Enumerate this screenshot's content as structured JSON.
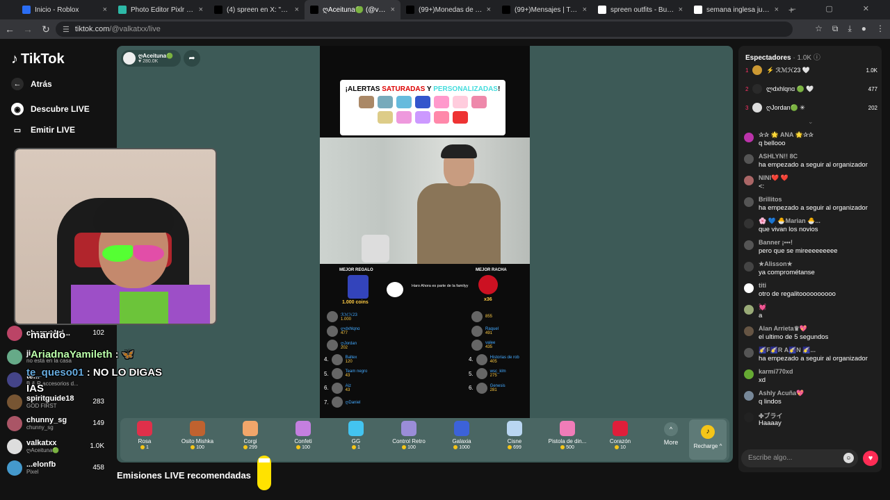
{
  "browser": {
    "tabs": [
      {
        "title": "Inicio - Roblox",
        "fav": "#2a6df4",
        "close": "×"
      },
      {
        "title": "Photo Editor Pixlr - Herra",
        "fav": "#2db9a7",
        "close": "×"
      },
      {
        "title": "(4) spreen en X: \"2 días p",
        "fav": "#000",
        "close": "×"
      },
      {
        "title": "ღAceituna🟢 (@valk",
        "fav": "#000",
        "close": "×",
        "active": true
      },
      {
        "title": "(99+)Monedas de TikTok",
        "fav": "#000",
        "close": "×"
      },
      {
        "title": "(99+)Mensajes | TikTok",
        "fav": "#000",
        "close": "×"
      },
      {
        "title": "spreen outfits - Buscar co",
        "fav": "#fff",
        "close": "×"
      },
      {
        "title": "semana inglesa juego co",
        "fav": "#fff",
        "close": "×"
      }
    ],
    "new_tab": "+",
    "url_host": "tiktok.com",
    "url_path": "/@valkatxx/live"
  },
  "sidebar": {
    "brand": "TikTok",
    "back": "Atrás",
    "discover": "Descubre LIVE",
    "emit": "Emitir LIVE",
    "channels": [
      {
        "name": "cherryabri...",
        "sub": "",
        "count": "102",
        "color": "#b46"
      },
      {
        "name": "ji...",
        "sub": "no está en la casa",
        "count": "",
        "color": "#6a8"
      },
      {
        "name": "te...",
        "sub": "B & R accesorios d...",
        "count": "",
        "color": "#448"
      },
      {
        "name": "spiritguide18",
        "sub": "GOD FIRST",
        "count": "283",
        "color": "#753"
      },
      {
        "name": "chunny_sg",
        "sub": "chunny_sg",
        "count": "149",
        "color": "#a56"
      },
      {
        "name": "valkatxx",
        "sub": "ღAceituna🟢",
        "count": "1.0K",
        "color": "#ddd"
      },
      {
        "name": "...elonfb",
        "sub": "Pixel",
        "count": "458",
        "color": "#49c"
      }
    ]
  },
  "player": {
    "host_name": "ღAceituna🟢",
    "host_likes": "♥ 280.0K",
    "alert_title_1": "¡ALERTAS",
    "alert_title_2": "SATURADAS",
    "alert_title_3": "Y",
    "alert_title_4": "PERSONALIZADAS",
    "alert_title_5": "!",
    "best_gift": "MEJOR REGALO",
    "best_streak": "MEJOR RACHA",
    "coins": "1.000 coins",
    "streak": "x36",
    "family": "Haro  Ahora es parte de la familyy",
    "left_rank": [
      {
        "n": "",
        "name": "ℛℳℋ23",
        "c": "1.000"
      },
      {
        "n": "",
        "name": "ლdxhlqnɑ",
        "c": "477"
      },
      {
        "n": "",
        "name": "ღJordan",
        "c": "202"
      },
      {
        "n": "4.",
        "name": "Baltex",
        "c": "120"
      },
      {
        "n": "5.",
        "name": "Team negro",
        "c": "43"
      },
      {
        "n": "6.",
        "name": "Aiz",
        "c": "43"
      },
      {
        "n": "7.",
        "name": "ღDaniel",
        "c": ""
      }
    ],
    "right_rank": [
      {
        "n": "",
        "name": "",
        "c": "855"
      },
      {
        "n": "",
        "name": "Raquel",
        "c": "491"
      },
      {
        "n": "",
        "name": "valee",
        "c": "435"
      },
      {
        "n": "4.",
        "name": "Historias de rob",
        "c": "405"
      },
      {
        "n": "5.",
        "name": "wsc_klm",
        "c": "275"
      },
      {
        "n": "6.",
        "name": "Genesis",
        "c": "281"
      }
    ],
    "overlay_chat": [
      {
        "user": "",
        "text": "marido"
      },
      {
        "user": "AriadnaYamileth",
        "text": ": 🦋"
      },
      {
        "user": "te_queso01",
        "text": ": NO LO DIGAS"
      },
      {
        "user": "",
        "text": "IAS"
      }
    ]
  },
  "gifts": [
    {
      "name": "Rosa",
      "price": "1",
      "color": "#e0304a"
    },
    {
      "name": "Osito Mishka",
      "price": "100",
      "color": "#c0622f"
    },
    {
      "name": "Corgi",
      "price": "299",
      "color": "#f2a66a"
    },
    {
      "name": "Confeti",
      "price": "100",
      "color": "#c47fe0"
    },
    {
      "name": "GG",
      "price": "1",
      "color": "#43c4f0"
    },
    {
      "name": "Control Retro",
      "price": "100",
      "color": "#9a8dd8"
    },
    {
      "name": "Galaxia",
      "price": "1000",
      "color": "#3c62d9"
    },
    {
      "name": "Cisne",
      "price": "699",
      "color": "#b9d6f2"
    },
    {
      "name": "Pistola de din...",
      "price": "500",
      "color": "#f07cb8"
    },
    {
      "name": "Corazón",
      "price": "10",
      "color": "#e01e3a"
    }
  ],
  "more_label": "More",
  "recharge_label": "Recharge ^",
  "recommended": "Emisiones LIVE recomendadas",
  "viewers": {
    "title": "Espectadores",
    "count": "· 1.0K",
    "top": [
      {
        "rank": "1",
        "name": "⚡ ℛℳℋ23 🤍",
        "count": "1.0K",
        "color": "#c93"
      },
      {
        "rank": "2",
        "name": "ლdxhlqnɑ 🟢 🤍",
        "count": "477",
        "color": "#2a2a2a"
      },
      {
        "rank": "3",
        "name": "ღJordan🟢 ✳",
        "count": "202",
        "color": "#ddd"
      }
    ]
  },
  "chat": [
    {
      "user": "✰✰ 🌟 ANA 🌟✰✰",
      "text": "q bellooo",
      "color": "#b3a"
    },
    {
      "user": "ASHLYN!! 8C",
      "text": "ha empezado a seguir al organizador",
      "color": "#555"
    },
    {
      "user": "NINI❤️ ❤️",
      "text": "<:",
      "color": "#a66"
    },
    {
      "user": "Brillitos",
      "text": "ha empezado a seguir al organizador",
      "color": "#555"
    },
    {
      "user": "🌸 💙 🐣Marian 🐣...",
      "text": "que vivan los novios",
      "color": "#333"
    },
    {
      "user": "Banner ¡•••!",
      "text": "pero que se mireeeeeeeee",
      "color": "#555"
    },
    {
      "user": "★Alisson★",
      "text": "ya comprométanse",
      "color": "#444"
    },
    {
      "user": "titi",
      "text": "otro de regalitoooooooooo",
      "color": "#fff"
    },
    {
      "user": "💓",
      "text": "a",
      "color": "#9a7"
    },
    {
      "user": "Alan Arrieta♛💖",
      "text": "el ultimo de 5 segundos",
      "color": "#654"
    },
    {
      "user": "🌠F🌠R A🌠N 🌠...",
      "text": "ha empezado a seguir al organizador",
      "color": "#555"
    },
    {
      "user": "karmi770xd",
      "text": "xd",
      "color": "#6a3"
    },
    {
      "user": "Ashly Acuña💖",
      "text": "q lindos",
      "color": "#789"
    },
    {
      "user": "✤ブライ",
      "text": "Haaaay",
      "color": "#222"
    }
  ],
  "chat_input_placeholder": "Escribe algo..."
}
